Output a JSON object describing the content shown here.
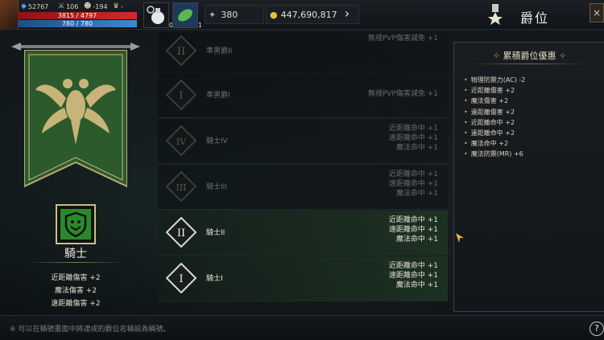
{
  "hud": {
    "level": "52767",
    "stat_a": "106",
    "stat_b": "-194",
    "stat_c": "-",
    "hp": "3815 / 4797",
    "mp": "780 / 780",
    "slot1_count": "0",
    "slot2_count": "1",
    "crystal": "380",
    "gold": "447,690,817"
  },
  "title": "爵位",
  "current_rank": {
    "name": "騎士",
    "bonuses": [
      "近距離傷害 +2",
      "魔法傷害 +2",
      "遠距離傷害 +2"
    ]
  },
  "ranks": [
    {
      "numeral": "II",
      "name": "準男爵II",
      "effects": [
        "無視PVP傷害減免 +1"
      ],
      "active": false
    },
    {
      "numeral": "I",
      "name": "準男爵I",
      "effects": [
        "無視PVP傷害減免 +1"
      ],
      "active": false
    },
    {
      "numeral": "IV",
      "name": "騎士IV",
      "effects": [
        "近距離命中 +1",
        "遠距離命中 +1",
        "魔法命中 +1"
      ],
      "active": false
    },
    {
      "numeral": "III",
      "name": "騎士III",
      "effects": [
        "近距離命中 +1",
        "遠距離命中 +1",
        "魔法命中 +1"
      ],
      "active": false
    },
    {
      "numeral": "II",
      "name": "騎士II",
      "effects": [
        "近距離命中 +1",
        "遠距離命中 +1",
        "魔法命中 +1"
      ],
      "active": true
    },
    {
      "numeral": "I",
      "name": "騎士I",
      "effects": [
        "近距離命中 +1",
        "遠距離命中 +1",
        "魔法命中 +1"
      ],
      "active": true
    }
  ],
  "cumulative": {
    "title": "累積爵位優惠",
    "items": [
      "物理防禦力(AC) -2",
      "近距離傷害 +2",
      "魔法傷害 +2",
      "遠距離傷害 +2",
      "近距離命中 +2",
      "遠距離命中 +2",
      "魔法命中 +2",
      "魔法防禦(MR) +6"
    ]
  },
  "footer_note": "※ 可以在稱號畫面中將達成的爵位名稱設為稱號。",
  "help_label": "?",
  "close_label": "×",
  "next_label": "›"
}
